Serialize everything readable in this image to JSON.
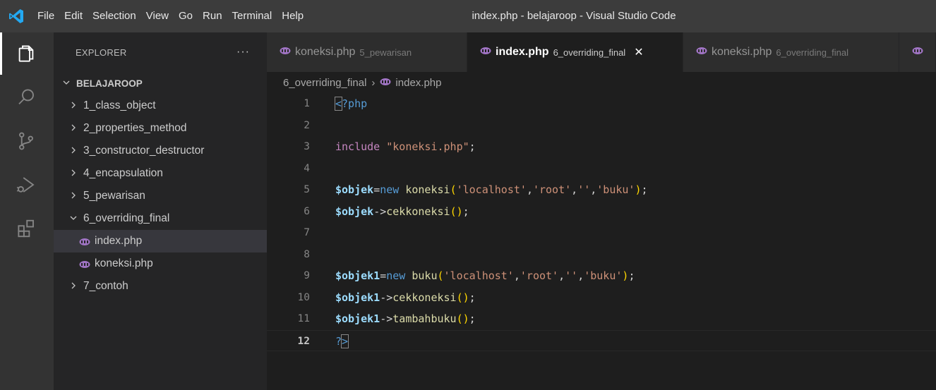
{
  "titlebar": {
    "menu": [
      "File",
      "Edit",
      "Selection",
      "View",
      "Go",
      "Run",
      "Terminal",
      "Help"
    ],
    "window_title": "index.php - belajaroop - Visual Studio Code"
  },
  "activitybar": {
    "items": [
      "explorer-icon",
      "search-icon",
      "source-control-icon",
      "run-debug-icon",
      "extensions-icon"
    ]
  },
  "sidebar": {
    "title": "EXPLORER",
    "more": "···",
    "root": "BELAJAROOP",
    "items": [
      {
        "label": "1_class_object",
        "type": "folder",
        "expanded": false
      },
      {
        "label": "2_properties_method",
        "type": "folder",
        "expanded": false
      },
      {
        "label": "3_constructor_destructor",
        "type": "folder",
        "expanded": false
      },
      {
        "label": "4_encapsulation",
        "type": "folder",
        "expanded": false
      },
      {
        "label": "5_pewarisan",
        "type": "folder",
        "expanded": false
      },
      {
        "label": "6_overriding_final",
        "type": "folder",
        "expanded": true
      },
      {
        "label": "index.php",
        "type": "file",
        "selected": true
      },
      {
        "label": "koneksi.php",
        "type": "file"
      },
      {
        "label": "7_contoh",
        "type": "folder",
        "expanded": false
      }
    ]
  },
  "tabs": [
    {
      "name": "koneksi.php",
      "desc": "5_pewarisan",
      "active": false
    },
    {
      "name": "index.php",
      "desc": "6_overriding_final",
      "active": true,
      "close": "✕"
    },
    {
      "name": "koneksi.php",
      "desc": "6_overriding_final",
      "active": false
    }
  ],
  "breadcrumb": {
    "folder": "6_overriding_final",
    "separator": "›",
    "file": "index.php"
  },
  "editor": {
    "active_line": 12,
    "line_numbers": [
      "1",
      "2",
      "3",
      "4",
      "5",
      "6",
      "7",
      "8",
      "9",
      "10",
      "11",
      "12"
    ],
    "lines": [
      "<?php",
      "",
      "include \"koneksi.php\";",
      "",
      "$objek=new koneksi('localhost','root','','buku');",
      "$objek->cekkoneksi();",
      "",
      "",
      "$objek1=new buku('localhost','root','','buku');",
      "$objek1->cekkoneksi();",
      "$objek1->tambahbuku();",
      "?>"
    ]
  },
  "colors": {
    "titlebar": "#3c3c3c",
    "activitybar": "#333333",
    "sidebar": "#252526",
    "editor": "#1e1e1e",
    "php_icon": "#a074c4"
  }
}
